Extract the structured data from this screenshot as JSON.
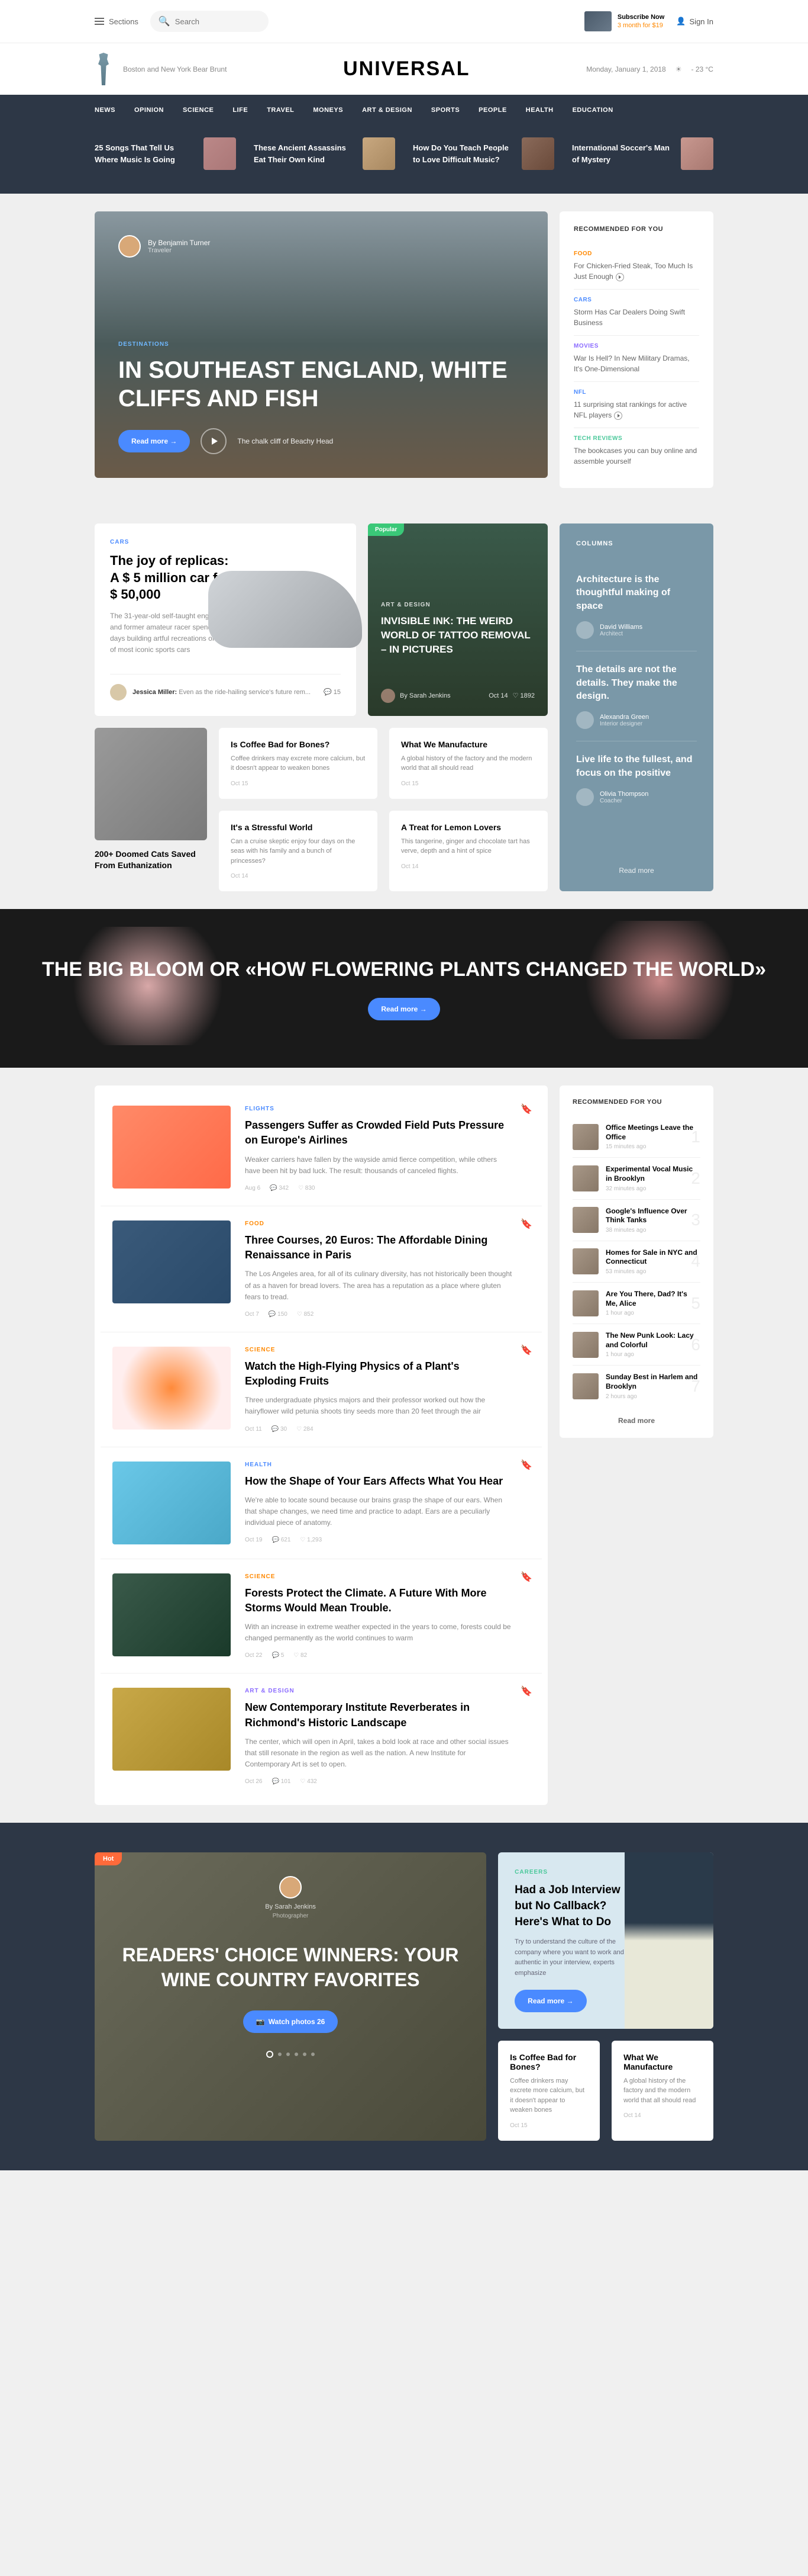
{
  "topbar": {
    "sections": "Sections",
    "search_placeholder": "Search",
    "subscribe_bold": "Subscribe Now",
    "subscribe_line": "3 month for $19",
    "signin": "Sign In"
  },
  "header": {
    "left_text": "Boston and New York Bear Brunt",
    "logo": "UNIVERSAL",
    "date": "Monday, January 1, 2018",
    "temp": "- 23 °C"
  },
  "nav": [
    "NEWS",
    "OPINION",
    "SCIENCE",
    "LIFE",
    "TRAVEL",
    "MONEYS",
    "ART & DESIGN",
    "SPORTS",
    "PEOPLE",
    "HEALTH",
    "EDUCATION"
  ],
  "trending": [
    "25 Songs That Tell Us Where Music Is Going",
    "These Ancient Assassins Eat Their Own Kind",
    "How Do You Teach People to Love Difficult Music?",
    "International Soccer's Man of Mystery"
  ],
  "hero": {
    "author": "By Benjamin Turner",
    "role": "Traveler",
    "cat": "DESTINATIONS",
    "title": "IN SOUTHEAST ENGLAND, WHITE CLIFFS AND FISH",
    "readmore": "Read more  →",
    "caption": "The chalk cliff of Beachy Head"
  },
  "recommended": {
    "title": "RECOMMENDED FOR YOU",
    "items": [
      {
        "cat": "FOOD",
        "catClass": "orange",
        "text": "For Chicken-Fried Steak, Too Much Is Just Enough",
        "play": true
      },
      {
        "cat": "CARS",
        "catClass": "blue",
        "text": "Storm Has Car Dealers Doing Swift Business"
      },
      {
        "cat": "MOVIES",
        "catClass": "purple",
        "text": "War Is Hell? In New Military Dramas, It's One-Dimensional"
      },
      {
        "cat": "NFL",
        "catClass": "blue",
        "text": "11 surprising stat rankings for active NFL players",
        "play": true
      },
      {
        "cat": "TECH REVIEWS",
        "catClass": "green",
        "text": "The bookcases you can buy online and assemble yourself"
      }
    ]
  },
  "joy": {
    "cat": "CARS",
    "title": "The joy of replicas: A $ 5 million car for $ 50,000",
    "desc": "The 31-year-old self-taught engineer and former amateur racer spends his days building artful recreations of one of most iconic sports cars",
    "author": "Jessica Miller:",
    "comment": "Even as the ride-hailing service's future rem...",
    "icon": "15"
  },
  "tattoo": {
    "badge": "Popular",
    "cat": "ART & DESIGN",
    "title": "INVISIBLE INK: THE WEIRD WORLD OF TATTOO REMOVAL – IN PICTURES",
    "author": "By Sarah Jenkins",
    "meta_time": "Oct 14",
    "meta_like": "1892"
  },
  "cat_card": {
    "title": "200+ Doomed Cats Saved From Euthanization"
  },
  "minis": [
    {
      "title": "Is Coffee Bad for Bones?",
      "desc": "Coffee drinkers may excrete more calcium, but it doesn't appear to weaken bones",
      "date": "Oct 15"
    },
    {
      "title": "What We Manufacture",
      "desc": "A global history of the factory and the modern world that all should read",
      "date": "Oct 15"
    },
    {
      "title": "It's a Stressful World",
      "desc": "Can a cruise skeptic enjoy four days on the seas with his family and a bunch of princesses?",
      "date": "Oct 14"
    },
    {
      "title": "A Treat for Lemon Lovers",
      "desc": "This tangerine, ginger and chocolate tart has verve, depth and a hint of spice",
      "date": "Oct 14"
    }
  ],
  "columns": {
    "title": "COLUMNS",
    "items": [
      {
        "title": "Architecture is the thoughtful making of space",
        "author": "David Williams",
        "role": "Architect"
      },
      {
        "title": "The details are not the details. They make the design.",
        "author": "Alexandra Green",
        "role": "Interior designer"
      },
      {
        "title": "Live life to the fullest, and focus on the positive",
        "author": "Olivia Thompson",
        "role": "Coacher"
      }
    ],
    "readmore": "Read more"
  },
  "bloom": {
    "title": "THE BIG BLOOM OR «HOW FLOWERING PLANTS CHANGED THE WORLD»",
    "btn": "Read more  →"
  },
  "articles": [
    {
      "cat": "FLIGHTS",
      "catClass": "blue",
      "title": "Passengers Suffer as Crowded Field Puts Pressure on Europe's Airlines",
      "desc": "Weaker carriers have fallen by the wayside amid fierce competition, while others have been hit by bad luck. The result: thousands of canceled flights.",
      "date": "Aug 6",
      "comments": "342",
      "likes": "830",
      "thumb": "at1"
    },
    {
      "cat": "FOOD",
      "catClass": "orange",
      "title": "Three Courses, 20 Euros: The Affordable Dining Renaissance in Paris",
      "desc": "The Los Angeles area, for all of its culinary diversity, has not historically been thought of as a haven for bread lovers. The area has a reputation as a place where gluten fears to tread.",
      "date": "Oct 7",
      "comments": "150",
      "likes": "852",
      "thumb": "at2"
    },
    {
      "cat": "SCIENCE",
      "catClass": "orange",
      "title": "Watch the High-Flying Physics of a Plant's Exploding Fruits",
      "desc": "Three undergraduate physics majors and their professor worked out how the hairyflower wild petunia shoots tiny seeds more than 20 feet through the air",
      "date": "Oct 11",
      "comments": "30",
      "likes": "284",
      "thumb": "at3",
      "bookmarked": true
    },
    {
      "cat": "HEALTH",
      "catClass": "blue",
      "title": "How the Shape of Your Ears Affects What You Hear",
      "desc": "We're able to locate sound because our brains grasp the shape of our ears. When that shape changes, we need time and practice to adapt. Ears are a peculiarly individual piece of anatomy.",
      "date": "Oct 19",
      "comments": "621",
      "likes": "1,293",
      "thumb": "at4"
    },
    {
      "cat": "SCIENCE",
      "catClass": "orange",
      "title": "Forests Protect the Climate. A Future With More Storms Would Mean Trouble.",
      "desc": "With an increase in extreme weather expected in the years to come, forests could be changed permanently as the world continues to warm",
      "date": "Oct 22",
      "comments": "5",
      "likes": "82",
      "thumb": "at5"
    },
    {
      "cat": "ART & DESIGN",
      "catClass": "purple",
      "title": "New Contemporary Institute Reverberates in Richmond's Historic Landscape",
      "desc": "The center, which will open in April, takes a bold look at race and other social issues that still resonate in the region as well as the nation. A new Institute for Contemporary Art is set to open.",
      "date": "Oct 26",
      "comments": "101",
      "likes": "432",
      "thumb": "at6"
    }
  ],
  "rec2": {
    "title": "RECOMMENDED FOR YOU",
    "items": [
      {
        "title": "Office Meetings Leave the Office",
        "time": "15 minutes ago"
      },
      {
        "title": "Experimental Vocal Music in Brooklyn",
        "time": "32 minutes ago"
      },
      {
        "title": "Google's Influence Over Think Tanks",
        "time": "38 minutes ago"
      },
      {
        "title": "Homes for Sale in NYC and Connecticut",
        "time": "53 minutes ago"
      },
      {
        "title": "Are You There, Dad? It's Me, Alice",
        "time": "1 hour ago"
      },
      {
        "title": "The New Punk Look: Lacy and Colorful",
        "time": "1 hour ago"
      },
      {
        "title": "Sunday Best in Harlem and Brooklyn",
        "time": "2 hours ago"
      }
    ],
    "readmore": "Read more"
  },
  "readers": {
    "hot": "Hot",
    "byline": "By Sarah Jenkins",
    "role": "Photographer",
    "title": "READERS' CHOICE WINNERS: YOUR WINE COUNTRY FAVORITES",
    "btn": "Watch photos  26"
  },
  "careers": {
    "cat": "CAREERS",
    "title": "Had a Job Interview but No Callback? Here's What to Do",
    "desc": "Try to understand the culture of the company where you want to work and be authentic in your interview, experts emphasize",
    "btn": "Read more  →"
  },
  "bottom_minis": [
    {
      "title": "Is Coffee Bad for Bones?",
      "desc": "Coffee drinkers may excrete more calcium, but it doesn't appear to weaken bones",
      "date": "Oct 15"
    },
    {
      "title": "What We Manufacture",
      "desc": "A global history of the factory and the modern world that all should read",
      "date": "Oct 14"
    }
  ]
}
